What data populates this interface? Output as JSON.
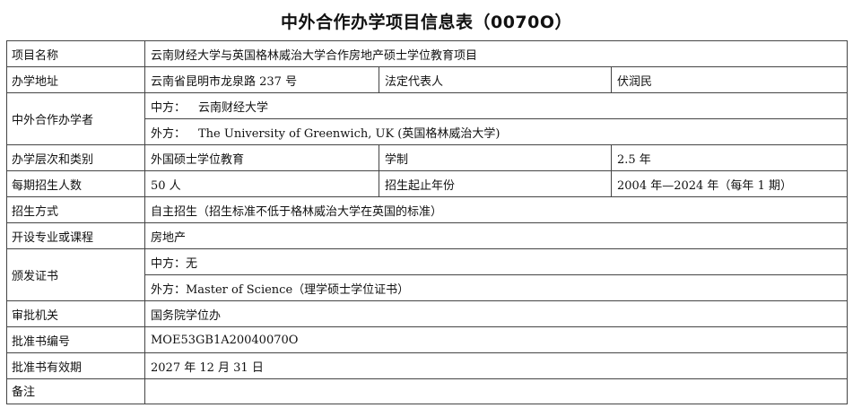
{
  "title": "中外合作办学项目信息表（0070O）",
  "rows": {
    "name": {
      "label": "项目名称",
      "value": "云南财经大学与英国格林威治大学合作房地产硕士学位教育项目"
    },
    "address": {
      "label": "办学地址",
      "value": "云南省昆明市龙泉路 237 号",
      "label2": "法定代表人",
      "value2": "伏润民"
    },
    "partners": {
      "label": "中外合作办学者",
      "cn_prefix": "中方：",
      "cn_value": "云南财经大学",
      "foreign_prefix": "外方：",
      "foreign_value": "The University of Greenwich, UK (英国格林威治大学)"
    },
    "level": {
      "label": "办学层次和类别",
      "value": "外国硕士学位教育",
      "label2": "学制",
      "value2": "2.5 年"
    },
    "enrollment": {
      "label": "每期招生人数",
      "value": "50 人",
      "label2": "招生起止年份",
      "value2": "2004 年—2024 年（每年 1 期）"
    },
    "method": {
      "label": "招生方式",
      "value": "自主招生（招生标准不低于格林威治大学在英国的标准）"
    },
    "program": {
      "label": "开设专业或课程",
      "value": "房地产"
    },
    "certificate": {
      "label": "颁发证书",
      "cn": "中方：无",
      "foreign": "外方：Master of Science（理学硕士学位证书）"
    },
    "authority": {
      "label": "审批机关",
      "value": "国务院学位办"
    },
    "approval_no": {
      "label": "批准书编号",
      "value": "MOE53GB1A20040070O"
    },
    "validity": {
      "label": "批准书有效期",
      "value": "2027 年 12 月 31 日"
    },
    "remarks": {
      "label": "备注",
      "value": ""
    }
  }
}
